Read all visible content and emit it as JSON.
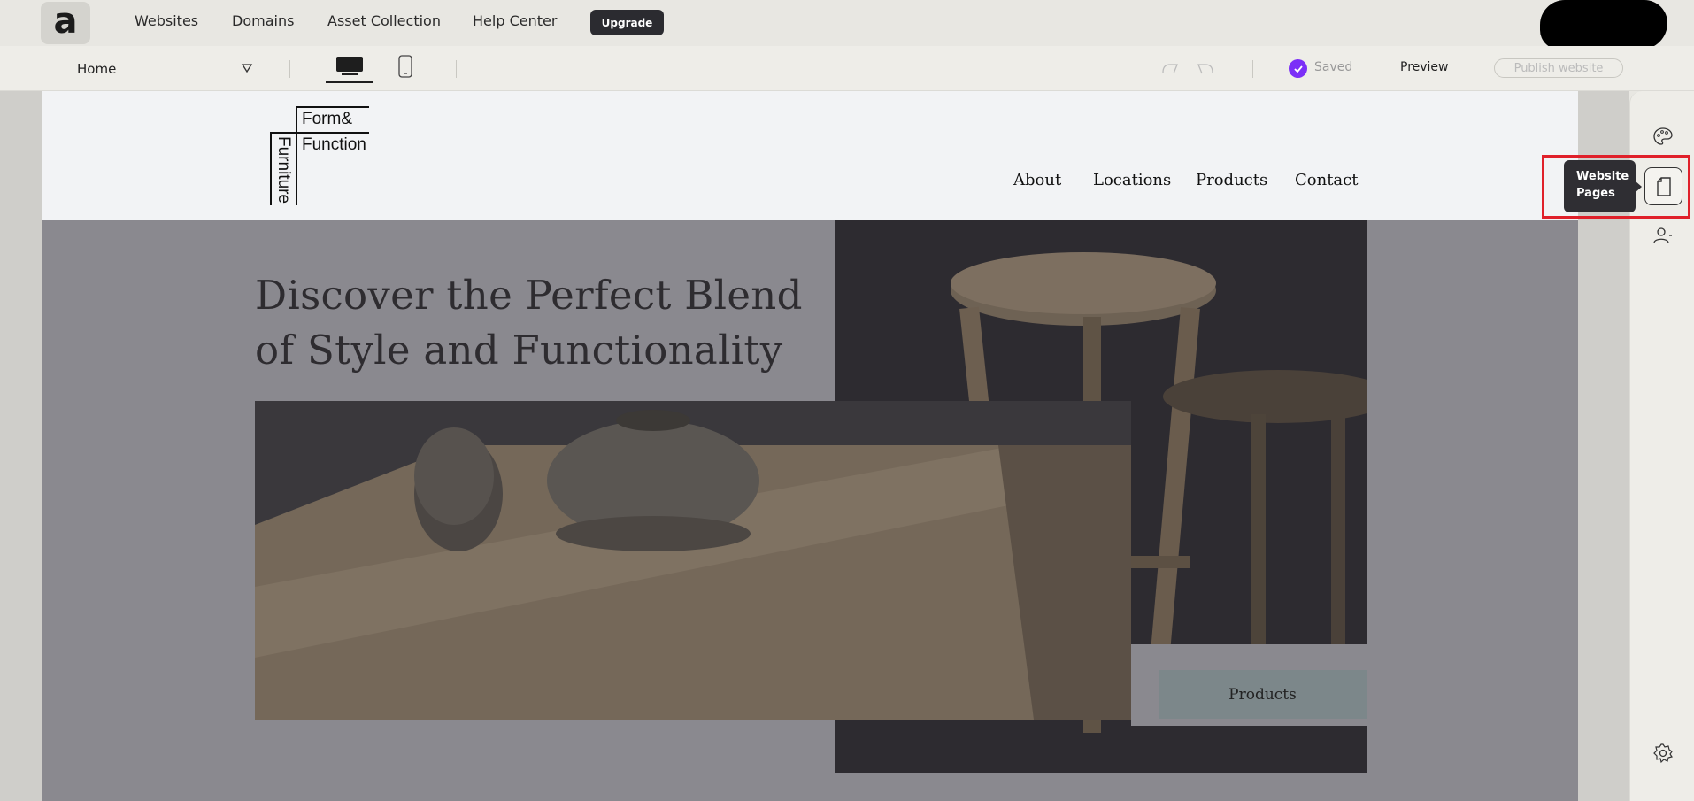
{
  "topnav": {
    "logo_letter": "a",
    "links": [
      "Websites",
      "Domains",
      "Asset Collection",
      "Help Center"
    ],
    "upgrade_label": "Upgrade"
  },
  "toolbar": {
    "page_selected": "Home",
    "saved_label": "Saved",
    "preview_label": "Preview",
    "publish_label": "Publish website"
  },
  "site": {
    "brand": {
      "line1": "Form&",
      "line2": "Function",
      "vertical": "Furniture"
    },
    "nav": [
      "About",
      "Locations",
      "Products",
      "Contact"
    ],
    "hero_title": "Discover the Perfect Blend of Style and Functionality",
    "cta_label": "Products"
  },
  "sidebar": {
    "icons": [
      "palette-icon",
      "page-icon",
      "users-icon",
      "gear-icon"
    ],
    "tooltip": "Website Pages"
  },
  "colors": {
    "accent": "#7b2ff7",
    "highlight": "#e0202a",
    "dark": "#2b2b30"
  }
}
